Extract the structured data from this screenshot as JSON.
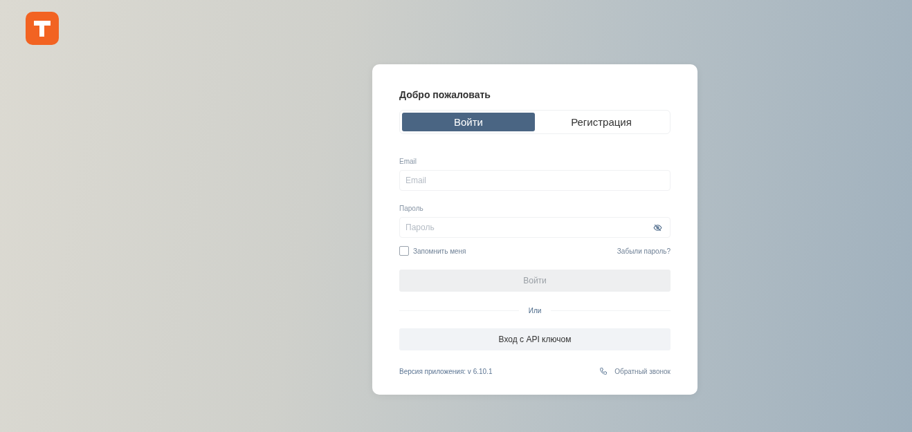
{
  "card": {
    "title": "Добро пожаловать",
    "tabs": [
      {
        "label": "Войти",
        "selected": true
      },
      {
        "label": "Регистрация",
        "selected": false
      }
    ],
    "fields": [
      {
        "kind": "text",
        "label": "Email",
        "placeholder": "Email"
      },
      {
        "kind": "password",
        "label": "Пароль",
        "placeholder": "Пароль"
      }
    ],
    "remember": {
      "label": "Запомнить меня",
      "checked": false
    },
    "forgot_link": "Забыли пароль?",
    "submit": {
      "label": "Войти",
      "disabled": true
    },
    "divider": "Или",
    "api_button": "Вход с API ключом",
    "version": "Версия приложения: v 6.10.1",
    "callback_link": "Обратный звонок"
  }
}
